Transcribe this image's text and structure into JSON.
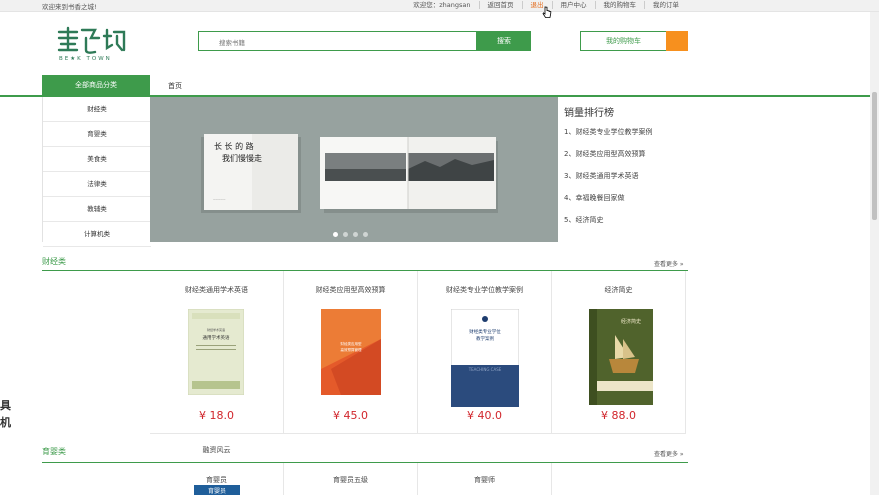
{
  "topbar": {
    "welcome": "欢迎来到书香之城!",
    "greeting": "欢迎您：zhangsan",
    "back_home": "返回首页",
    "logout": "退出",
    "user_center": "用户中心",
    "my_cart": "我的购物车",
    "my_orders": "我的订单"
  },
  "header": {
    "search_placeholder": "搜索书籍",
    "search_button": "搜索",
    "cart_button": "我的购物车"
  },
  "nav": {
    "all_categories": "全部商品分类",
    "home": "首页"
  },
  "categories": [
    "财经类",
    "育婴类",
    "美食类",
    "法律类",
    "教辅类",
    "计算机类"
  ],
  "ranking": {
    "title": "销量排行榜",
    "items": [
      "1、财经类专业学位教学案例",
      "2、财经类应用型高效预算",
      "3、财经类通用学术英语",
      "4、幸福晚餐回家做",
      "5、经济简史"
    ]
  },
  "sections": [
    {
      "title": "财经类",
      "more": "查看更多 »",
      "books": [
        {
          "name": "财经类通用学术英语",
          "price": "¥ 18.0"
        },
        {
          "name": "财经类应用型高效预算",
          "price": "¥ 45.0"
        },
        {
          "name": "财经类专业学位教学案例",
          "price": "¥ 40.0"
        },
        {
          "name": "经济简史",
          "price": "¥ 88.0"
        }
      ],
      "extra_book": "融资风云"
    },
    {
      "title": "育婴类",
      "more": "查看更多 »",
      "books": [
        {
          "name": "育婴员"
        },
        {
          "name": "育婴员五级"
        },
        {
          "name": "育婴师"
        }
      ]
    }
  ],
  "banner": {
    "book1_title": "长长的路 我们慢慢走",
    "slides": 4,
    "active_slide": 1
  },
  "edge_text": [
    "具",
    "机"
  ],
  "colors": {
    "brand_green": "#3e9b4b",
    "price_red": "#d1262c",
    "cart_orange": "#f7901e",
    "logout_orange": "#e36b1b"
  }
}
